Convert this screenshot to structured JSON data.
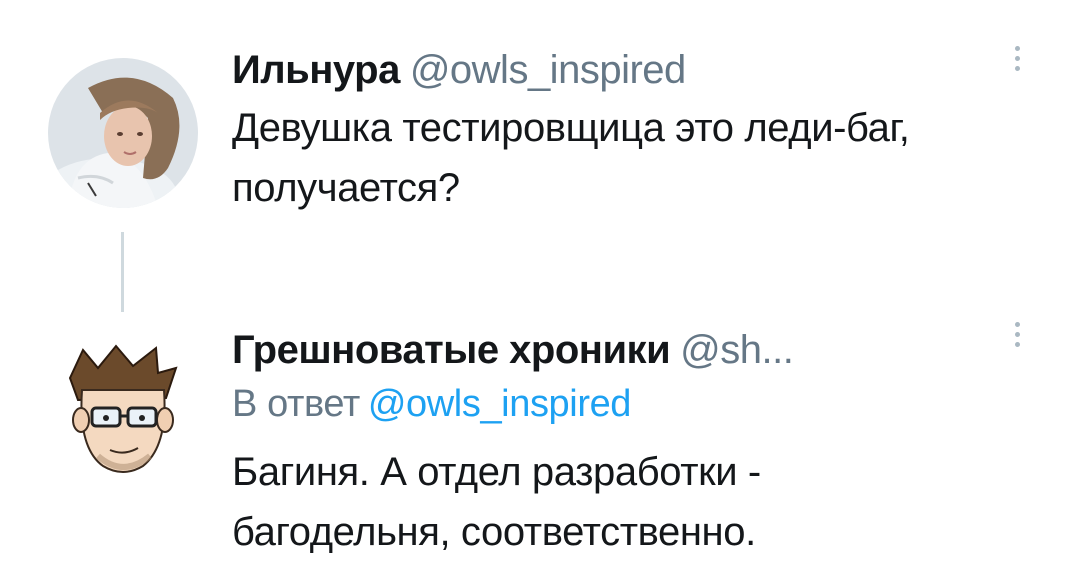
{
  "tweets": [
    {
      "name": "Ильнура",
      "handle": "@owls_inspired",
      "lines": [
        "Девушка тестировщица это леди-баг,",
        "получается?"
      ],
      "avatar_icon": "user-avatar-photo"
    },
    {
      "name": "Грешноватые хроники",
      "handle": "@sh...",
      "reply_prefix": "В ответ",
      "reply_mention": "@owls_inspired",
      "lines": [
        "Багиня. А отдел разработки -",
        "багодельня, соответственно."
      ],
      "avatar_icon": "cartoon-avatar"
    }
  ],
  "icons": {
    "more": "more-vertical-icon"
  },
  "colors": {
    "text": "#14171a",
    "secondary": "#657786",
    "link": "#1da1f2",
    "thread_line": "#cfd9de"
  }
}
